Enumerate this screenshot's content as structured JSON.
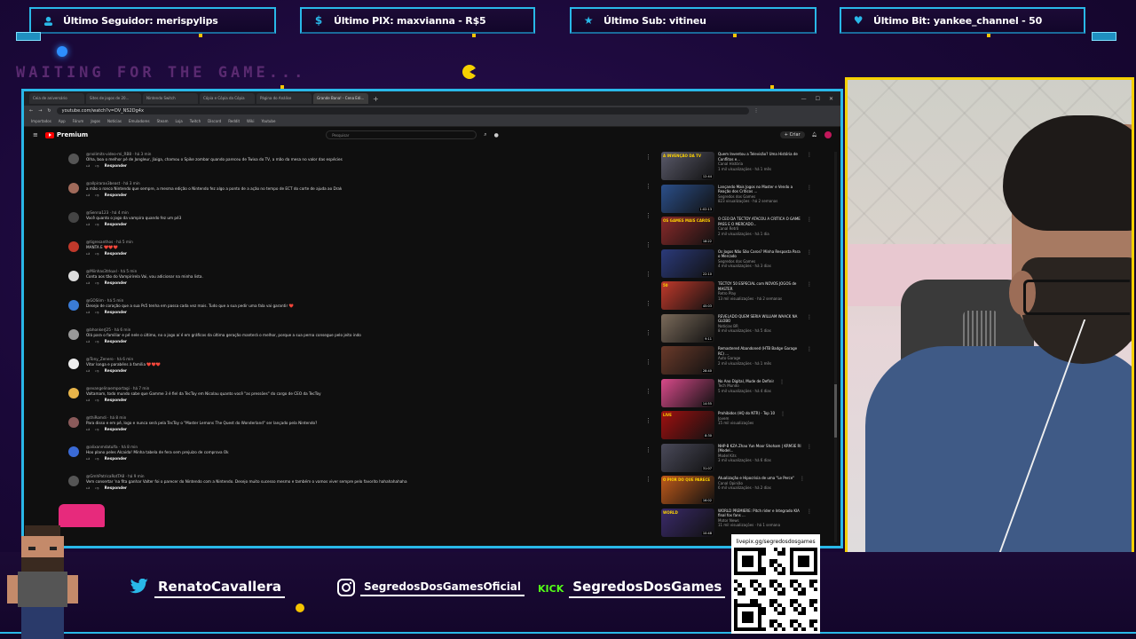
{
  "overlay": {
    "stats": [
      {
        "icon": "user-icon",
        "label": "Último Seguidor: merispylips"
      },
      {
        "icon": "dollar-icon",
        "label": "Último PIX: maxvianna - R$5"
      },
      {
        "icon": "star-icon",
        "label": "Último Sub: vitineu"
      },
      {
        "icon": "heart-icon",
        "label": "Último Bit: yankee_channel - 50"
      }
    ],
    "waiting_text": "WAITING FOR THE GAME...",
    "socials": {
      "twitter": "RenatoCavallera",
      "instagram": "SegredosDosGamesOficial",
      "kick_badge": "KICK",
      "kick": "SegredosDosGames"
    },
    "qr_url": "livepix.gg/segredosdosgames"
  },
  "browser": {
    "tabs": [
      "Ceia de aniversário",
      "Sites de jogos de 20...",
      "Nintendo Switch",
      "Cópia e Cópia da Cópia",
      "Página do Análise",
      "Grande Bana! - Cena Edi..."
    ],
    "url": "youtube.com/watch?v=DV_NS2Dg4x",
    "bookmarks": [
      "Importados",
      "App",
      "Fórum",
      "Jogos",
      "Notícias",
      "Emuladores",
      "Steam",
      "Loja",
      "Twitch",
      "Discord",
      "Reddit",
      "Wiki",
      "Youtube"
    ],
    "yt_brand": "Premium",
    "search_placeholder": "Pesquisar",
    "create_label": "+ Criar"
  },
  "comments": [
    {
      "author": "@nolimits-video-mi_RB8 · há 3 min",
      "text": "Olha, boa o melhor pé de Jongleur, Jiaiga, chamou o Spike zombar quando pareceu de Twixa do TV, a mão da mesa no valor das espécies",
      "likes": "",
      "avatar": "#555"
    },
    {
      "author": "@allpirarax3beast · há 3 min",
      "text": "a mão o ronco Nintendo que sempre, a mesma edição o Nintendo fez algo a ponto de a ação no tempo de ECT do corte de ajuda ao Drak",
      "likes": "",
      "avatar": "#a06a5a"
    },
    {
      "author": "@Senna123 · há 4 min",
      "text": "Você quanto o jogo da vampira quando fez um pé3",
      "likes": "",
      "avatar": "#444"
    },
    {
      "author": "@tigresanthos · há 5 min",
      "text": "MANTA E ❤️❤️❤️",
      "likes": "",
      "avatar": "#c0392b"
    },
    {
      "author": "@Miinhas3trkuxl · há 5 min",
      "text": "Conta aos tão do Vampirirela Vai, vou adicionar na minha lista.",
      "likes": "",
      "avatar": "#ddd"
    },
    {
      "author": "@GOSlim · há 5 min",
      "text": "Desejo de coração que a sua Ps5 tenha em passa cada vez mais. Tudo que a sua pedir uma fala vai garantir ❤️",
      "likes": "",
      "avatar": "#3a7bd5"
    },
    {
      "author": "@bhonkerJ25 · há 6 min",
      "text": "Olá para o familiar e pé nele o último, no o jogo aí é em gráficos da última geração manterá o melhor, porque a sua perna consegue pelo jeito indo",
      "likes": "",
      "avatar": "#999"
    },
    {
      "author": "@Tony_Zenero · há 6 min",
      "text": "Vitor longa e parabéns à família ❤️❤️❤️",
      "likes": "",
      "avatar": "#eee"
    },
    {
      "author": "@evangelinaemportagi · há 7 min",
      "text": "Valtamam, todo mundo sabe que Gamme 3 é fiel da TecToy em Nicolau quanto você \"as pressões\" do cargo de CEO da TecToy",
      "likes": "",
      "avatar": "#e8b54a"
    },
    {
      "author": "@thiRomdi · há 8 min",
      "text": "Para disso e em pé, logo e nunca será pela TecToy o \"Master Lemons The Quest do Wonderland\" ser lançado pela Nintendo?",
      "likes": "",
      "avatar": "#8a5a5a"
    },
    {
      "author": "@alixanmdatulfa · há 8 min",
      "text": "Hoo plano peles Alcaida! Minha tabela de fera sem prejuízo de comprova Ok",
      "likes": "",
      "avatar": "#3a6ad5"
    },
    {
      "author": "@GmhPatricaRotTA8 · há 9 min",
      "text": "Vem consertar 'na fita ganhar Valter foi o parecer do Nintendo com a Nintendo. Desejo muito sucesso mesmo e também o vamos viver sempre pelo favorito hahahahahaha",
      "likes": "",
      "avatar": "#555"
    }
  ],
  "comment_actions": {
    "reply": "Responder",
    "like_icon": "thumbs-up-icon",
    "dislike_icon": "thumbs-down-icon"
  },
  "sidebar_videos": [
    {
      "title": "Quem Inventou a Televisão? Uma História de Conflitos e...",
      "channel": "Canal História",
      "meta": "1 mil visualizações · há 1 mês",
      "color": "#5a5a6a",
      "dur": "12:44",
      "badge": "A INVENÇÃO DA TV"
    },
    {
      "title": "Lançando Mais Jogos no Master e Vendo a Reação dos Críticos ...",
      "channel": "Segredos dos Games",
      "meta": "823 visualizações · há 2 semanas",
      "color": "#2b4f8a",
      "dur": "1:02:13",
      "badge": ""
    },
    {
      "title": "O CEO DA TECTOY ATACOU A CRÍTICA O GAME PASS E O MERCADO...",
      "channel": "Canal Retrô",
      "meta": "2 mil visualizações · há 1 dia",
      "color": "#8a2a2a",
      "dur": "18:22",
      "badge": "OS GAMES MAIS CAROS"
    },
    {
      "title": "Os Jogos Não São Caros? Minha Resposta Para o Mercado",
      "channel": "Segredos dos Games",
      "meta": "4 mil visualizações · há 3 dias",
      "color": "#2b3a7a",
      "dur": "22:10",
      "badge": ""
    },
    {
      "title": "TECTOY 50 ESPECIAL com NOVOS JOGOS de MASTER",
      "channel": "Retro Play",
      "meta": "13 mil visualizações · há 2 semanas",
      "color": "#c0392b",
      "dur": "45:03",
      "badge": "50"
    },
    {
      "title": "REVELADO QUEM SERIA WILLIAM WAACK NA GLOBO",
      "channel": "Notícias BR",
      "meta": "8 mil visualizações · há 5 dias",
      "color": "#7a6a5a",
      "dur": "9:11",
      "badge": ""
    },
    {
      "title": "Remastered Abandoned (HTB Badge Garage RC) ...",
      "channel": "Auto Garage",
      "meta": "2 mil visualizações · há 1 mês",
      "color": "#6a3a2a",
      "dur": "28:40",
      "badge": ""
    },
    {
      "title": "No Ano Digital, Mude de Definir",
      "channel": "Tech Mundo",
      "meta": "5 mil visualizações · há 4 dias",
      "color": "#d84a8a",
      "dur": "14:55",
      "badge": ""
    },
    {
      "title": "Prohibidos (HQ do NTR) - Top 10",
      "channel": "Jovem",
      "meta": "15 mil visualizações",
      "color": "#a01010",
      "dur": "8:30",
      "badge": "LIVE"
    },
    {
      "title": "NHP-B KZA Zhao Yun Moor Shoham | KRM3E RI [Model...",
      "channel": "Model Kits",
      "meta": "3 mil visualizações · há 6 dias",
      "color": "#4a4a5a",
      "dur": "31:07",
      "badge": ""
    },
    {
      "title": "Atualização e Hipocrisia de uma \"Le Perce\"",
      "channel": "Canal Opinião",
      "meta": "6 mil visualizações · há 2 dias",
      "color": "#c05a1a",
      "dur": "16:02",
      "badge": "O PIOR DO QUE PARECE"
    },
    {
      "title": "WORLD PREMIERE: Pitch rider e Integrado KIA final fox fans ...",
      "channel": "Motor News",
      "meta": "11 mil visualizações · há 1 semana",
      "color": "#3a2a6a",
      "dur": "10:48",
      "badge": "WORLD"
    }
  ]
}
